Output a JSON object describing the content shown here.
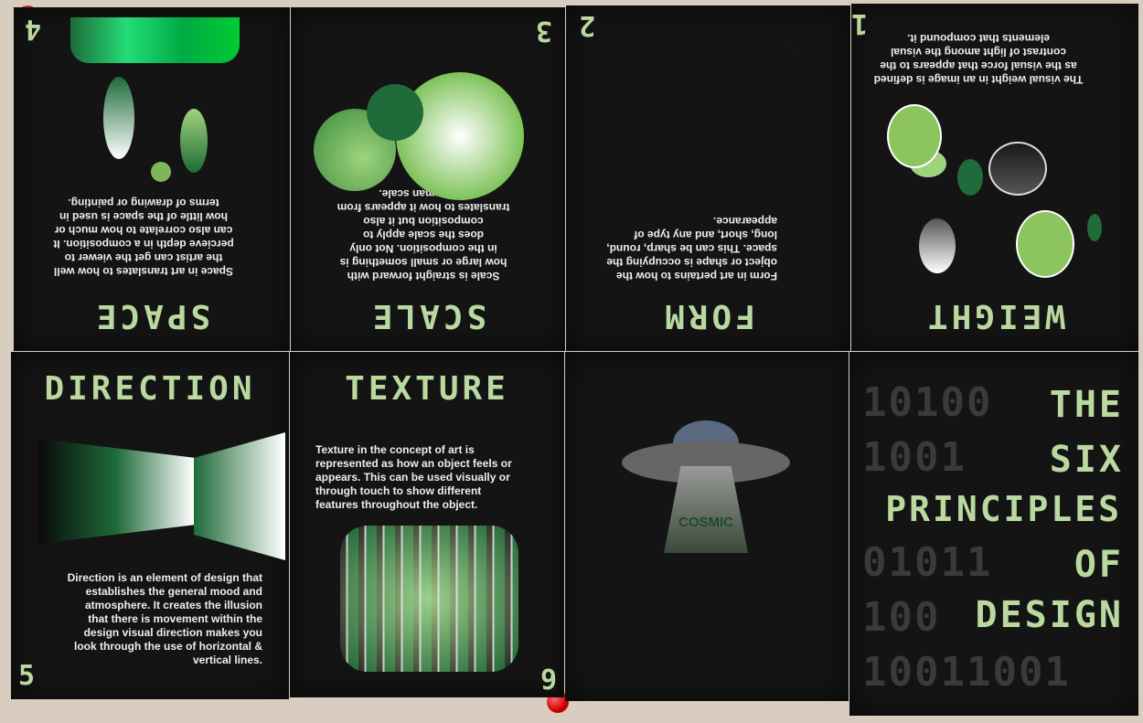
{
  "panels": {
    "weight": {
      "title": "WEIGHT",
      "number": "1",
      "text": "The visual weight in an image is defined as the visual force that appears to the contrast of light among the visual elements that compound it."
    },
    "form": {
      "title": "FORM",
      "number": "2",
      "text": "Form in art pertains to how the object or shape is occupying the space. This can be sharp, round, long, short, and any type of appearance."
    },
    "scale": {
      "title": "SCALE",
      "number": "3",
      "text": "Scale is straight forward with how large or small something is in the composition. Not only does the scale apply to composition but it also translates to how it appears from the human scale."
    },
    "space": {
      "title": "SPACE",
      "number": "4",
      "text": "Space in art translates to how well the artist can get the viewer to percieve depth in a composition. It can also correlate to how much or how little of the space is used in terms of drawing or painting."
    },
    "direction": {
      "title": "DIRECTION",
      "number": "5",
      "text": "Direction is an element of design that establishes the general mood and atmosphere. It creates the illusion that there is movement within the design visual direction makes you look through the use of horizontal & vertical lines."
    },
    "texture": {
      "title": "TEXTURE",
      "number": "6",
      "text": "Texture in the concept of art is represented as how an object feels or appears. This can be used visually or through touch to show different features throughout the object."
    },
    "cosmic": {
      "label": "COSMIC"
    },
    "cover": {
      "lines": [
        "THE",
        "SIX",
        "PRINCIPLES",
        "OF",
        "DESIGN"
      ],
      "binary": [
        "10100",
        "1001",
        "01011",
        "100",
        "10011001"
      ]
    }
  }
}
